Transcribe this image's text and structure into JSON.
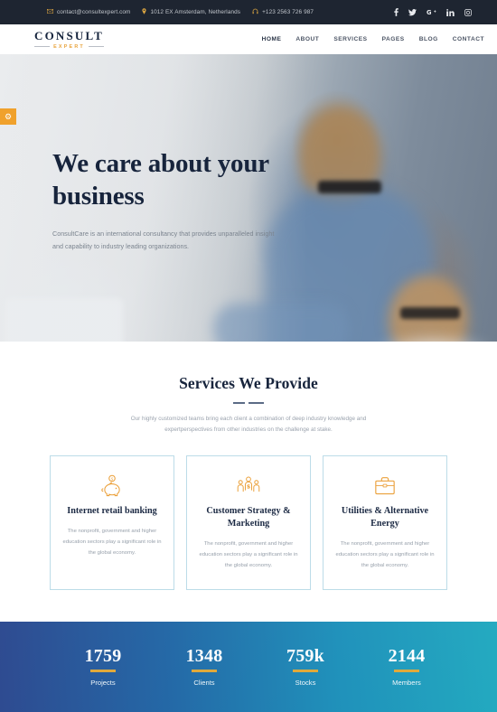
{
  "topbar": {
    "email": "contact@consultexpert.com",
    "email_icon": "envelope-icon",
    "address": "1012 EX Amsterdam, Netherlands",
    "address_icon": "map-pin-icon",
    "phone": "+123 2563 726 987",
    "phone_icon": "headset-icon",
    "socials": [
      {
        "name": "facebook-icon",
        "glyph": "f"
      },
      {
        "name": "twitter-icon",
        "glyph": "t"
      },
      {
        "name": "google-plus-icon",
        "glyph": "G+"
      },
      {
        "name": "linkedin-icon",
        "glyph": "in"
      },
      {
        "name": "instagram-icon",
        "glyph": "ig"
      }
    ]
  },
  "brand": {
    "name": "CONSULT",
    "tagline": "EXPERT"
  },
  "nav": {
    "items": [
      {
        "label": "HOME",
        "active": true
      },
      {
        "label": "ABOUT",
        "active": false
      },
      {
        "label": "SERVICES",
        "active": false
      },
      {
        "label": "PAGES",
        "active": false
      },
      {
        "label": "BLOG",
        "active": false
      },
      {
        "label": "CONTACT",
        "active": false
      }
    ]
  },
  "options_tab": {
    "icon": "gear-icon",
    "glyph": "⚙"
  },
  "hero": {
    "title": "We care about your business",
    "text": "ConsultCare is an international consultancy that provides unparalleled insight and capability to industry leading organizations."
  },
  "services": {
    "title": "Services We Provide",
    "subtitle": "Our highly customized teams bring each client a combination of deep industry knowledge and expertperspectives from other industries on the challenge at stake.",
    "cards": [
      {
        "icon": "piggy-bank-icon",
        "title": "Internet retail banking",
        "text": "The nonprofit, government and higher education sectors play a significant role in the global economy."
      },
      {
        "icon": "customer-strategy-icon",
        "title": "Customer Strategy & Marketing",
        "text": "The nonprofit, government and higher education sectors play a significant role in the global economy."
      },
      {
        "icon": "briefcase-icon",
        "title": "Utilities & Alternative Energy",
        "text": "The nonprofit, government and higher education sectors play a significant role in the global economy."
      }
    ]
  },
  "counters": [
    {
      "value": "1759",
      "label": "Projects"
    },
    {
      "value": "1348",
      "label": "Clients"
    },
    {
      "value": "759k",
      "label": "Stocks"
    },
    {
      "value": "2144",
      "label": "Members"
    }
  ],
  "colors": {
    "topbar_bg": "#1e2531",
    "brand_navy": "#16243d",
    "accent_gold": "#e8a33d",
    "orange_tab": "#f0a12c",
    "card_border": "#bcdce8",
    "counter_start": "#2c4992",
    "counter_end": "#1fb1c7"
  }
}
